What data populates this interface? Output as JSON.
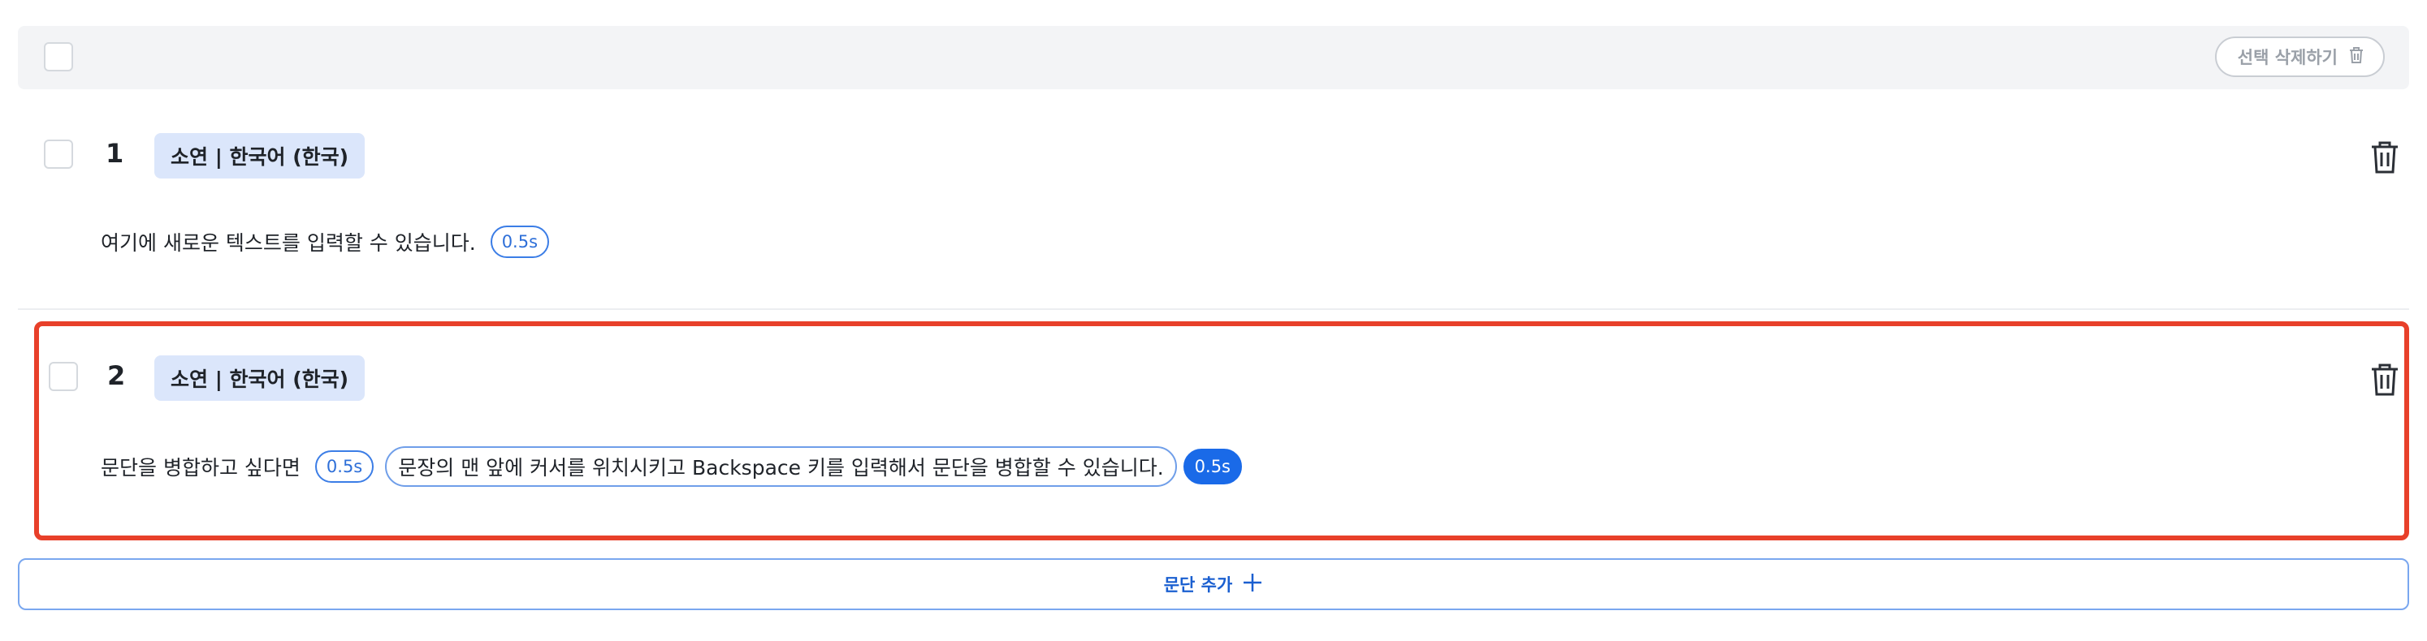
{
  "toolbar": {
    "delete_selected_label": "선택 삭제하기",
    "delete_icon": "trash-icon"
  },
  "paragraphs": [
    {
      "number": "1",
      "voice": "소연 | 한국어 (한국)",
      "text": "여기에 새로운 텍스트를 입력할 수 있습니다.",
      "pause": "0.5s"
    },
    {
      "number": "2",
      "voice": "소연 | 한국어 (한국)",
      "text": "문단을 병합하고 싶다면",
      "pause": "0.5s",
      "sentence": "문장의 맨 앞에 커서를 위치시키고 Backspace 키를 입력해서 문단을 병합할 수 있습니다.",
      "sentence_pause": "0.5s",
      "highlighted": true
    }
  ],
  "add_paragraph_label": "문단 추가",
  "add_icon": "plus-icon",
  "colors": {
    "accent": "#1a6ae8",
    "highlight_border": "#e8402a",
    "voice_tag_bg": "#dbe6fb",
    "toolbar_bg": "#f3f4f6"
  }
}
